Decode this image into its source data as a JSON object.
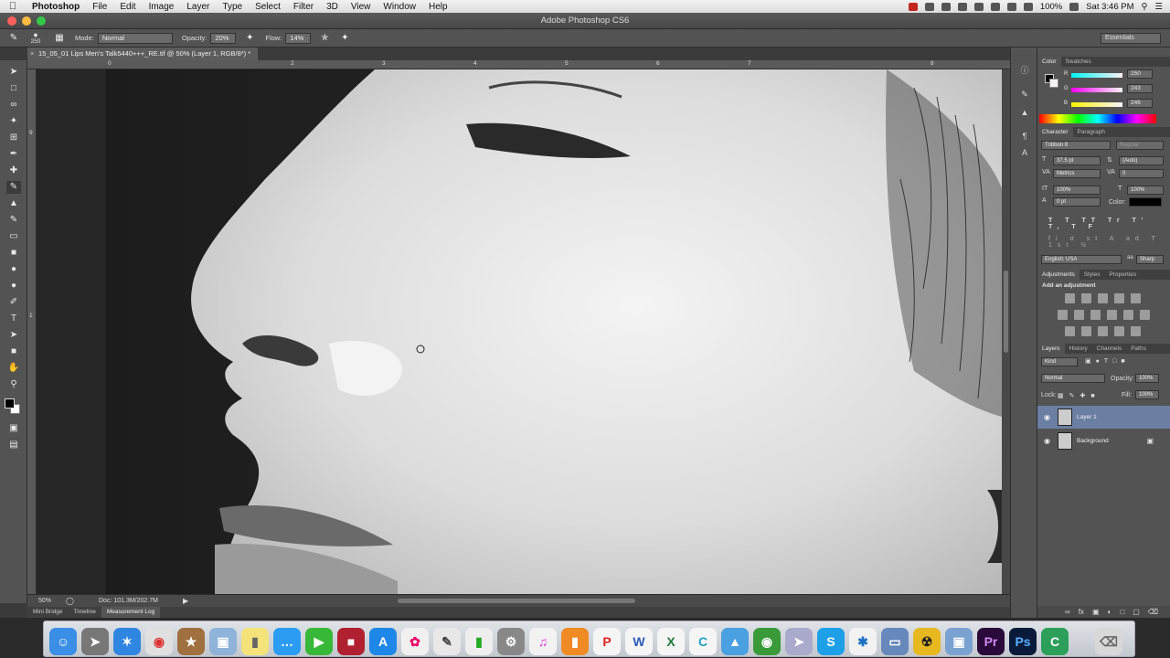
{
  "menubar": {
    "apple_icon": "apple-icon",
    "app_name": "Photoshop",
    "menus": [
      "File",
      "Edit",
      "Image",
      "Layer",
      "Type",
      "Select",
      "Filter",
      "3D",
      "View",
      "Window",
      "Help"
    ],
    "battery": "100%",
    "clock": "Sat 3:46 PM"
  },
  "window": {
    "title": "Adobe Photoshop CS6"
  },
  "options": {
    "brush_size": "250",
    "mode_label": "Mode:",
    "mode_value": "Normal",
    "opacity_label": "Opacity:",
    "opacity_value": "20%",
    "flow_label": "Flow:",
    "flow_value": "14%",
    "workspace": "Essentials"
  },
  "document": {
    "tab_title": "15_05_01 Lips Men's Talk5440+++_RE.tif @ 50% (Layer 1, RGB/8*) *",
    "ruler_top": [
      "0",
      "2",
      "3",
      "4",
      "5",
      "6",
      "7",
      "8"
    ],
    "ruler_left": [
      "9",
      "1"
    ]
  },
  "status": {
    "zoom": "50%",
    "doc_size": "Doc: 101.3M/202.7M"
  },
  "bottom_tabs": [
    "Mini Bridge",
    "Timeline",
    "Measurement Log"
  ],
  "color_panel": {
    "tabs": [
      "Color",
      "Swatches"
    ],
    "r": "250",
    "g": "243",
    "b": "246",
    "r_label": "R",
    "g_label": "G",
    "b_label": "B"
  },
  "character_panel": {
    "tabs": [
      "Character",
      "Paragraph"
    ],
    "font": "Tribbon 8",
    "style": "Regular",
    "size": "37.5 pt",
    "leading": "(Auto)",
    "kerning": "Metrics",
    "tracking": "0",
    "vscale": "100%",
    "hscale": "100%",
    "baseline": "0 pt",
    "color_label": "Color:",
    "language": "English: USA",
    "aa": "Sharp"
  },
  "adjustments_panel": {
    "tabs": [
      "Adjustments",
      "Styles",
      "Properties"
    ],
    "heading": "Add an adjustment"
  },
  "layers_panel": {
    "tabs": [
      "Layers",
      "History",
      "Channels",
      "Paths"
    ],
    "kind": "Kind",
    "blend": "Normal",
    "opacity_label": "Opacity:",
    "opacity": "100%",
    "lock_label": "Lock:",
    "fill_label": "Fill:",
    "fill": "100%",
    "layers": [
      {
        "name": "Layer 1",
        "selected": true
      },
      {
        "name": "Background",
        "selected": false
      }
    ]
  },
  "dock": {
    "apps": [
      "Finder",
      "Launchpad",
      "Safari",
      "Chrome",
      "Contacts",
      "Preview",
      "Stickies",
      "Messages",
      "FaceTime",
      "Photo Booth",
      "App Store",
      "Photos",
      "TextEdit",
      "Numbers",
      "System Preferences",
      "iTunes",
      "iBooks",
      "Pages",
      "Word",
      "Excel",
      "Camtasia",
      "Keynote",
      "Globe",
      "Migration",
      "Skype",
      "Bluetooth",
      "Wallet",
      "Nuke",
      "Preview",
      "Premiere",
      "Photoshop",
      "Camtasia Recorder",
      "Trash"
    ]
  }
}
